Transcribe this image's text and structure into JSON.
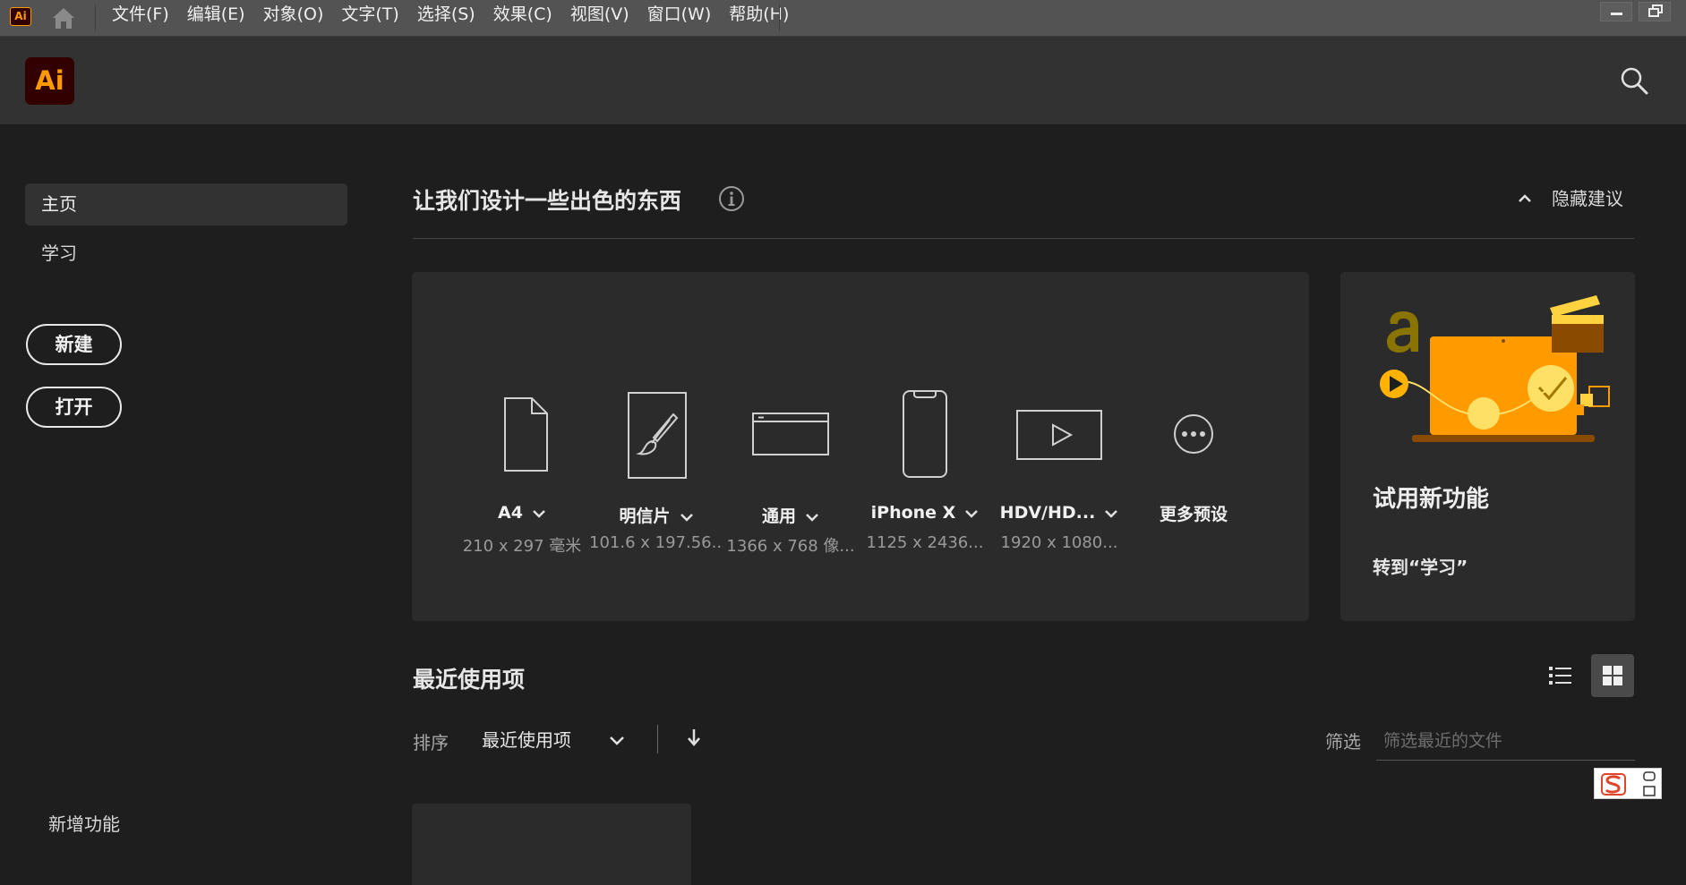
{
  "menubar": {
    "app_icon": "Ai",
    "items": [
      "文件(F)",
      "编辑(E)",
      "对象(O)",
      "文字(T)",
      "选择(S)",
      "效果(C)",
      "视图(V)",
      "窗口(W)",
      "帮助(H)"
    ]
  },
  "header": {
    "logo": "Ai",
    "search_icon": "search-icon"
  },
  "sidebar": {
    "nav": [
      {
        "label": "主页",
        "active": true
      },
      {
        "label": "学习",
        "active": false
      }
    ],
    "new_button": "新建",
    "open_button": "打开",
    "whats_new": "新增功能"
  },
  "main": {
    "heading": "让我们设计一些出色的东西",
    "hide_tips": "隐藏建议",
    "presets": [
      {
        "name": "A4",
        "size": "210 x 297 毫米",
        "icon": "document-icon"
      },
      {
        "name": "明信片",
        "size": "101.6 x 197.56...",
        "icon": "postcard-brush-icon"
      },
      {
        "name": "通用",
        "size": "1366 x 768 像...",
        "icon": "web-browser-icon"
      },
      {
        "name": "iPhone X",
        "size": "1125 x 2436...",
        "icon": "phone-icon"
      },
      {
        "name": "HDV/HD...",
        "size": "1920 x 1080...",
        "icon": "video-play-icon"
      },
      {
        "name": "更多预设",
        "size": "",
        "icon": "more-dots-icon"
      }
    ],
    "learn_card": {
      "title": "试用新功能",
      "link": "转到“学习”"
    },
    "recent": {
      "title": "最近使用项",
      "sort_label": "排序",
      "sort_value": "最近使用项",
      "filter_label": "筛选",
      "filter_placeholder": "筛选最近的文件"
    }
  },
  "colors": {
    "ai_orange": "#ff9a00",
    "ai_dark": "#330000",
    "illustration_orange": "#ff9b00",
    "illustration_yellow": "#ffd23f"
  }
}
